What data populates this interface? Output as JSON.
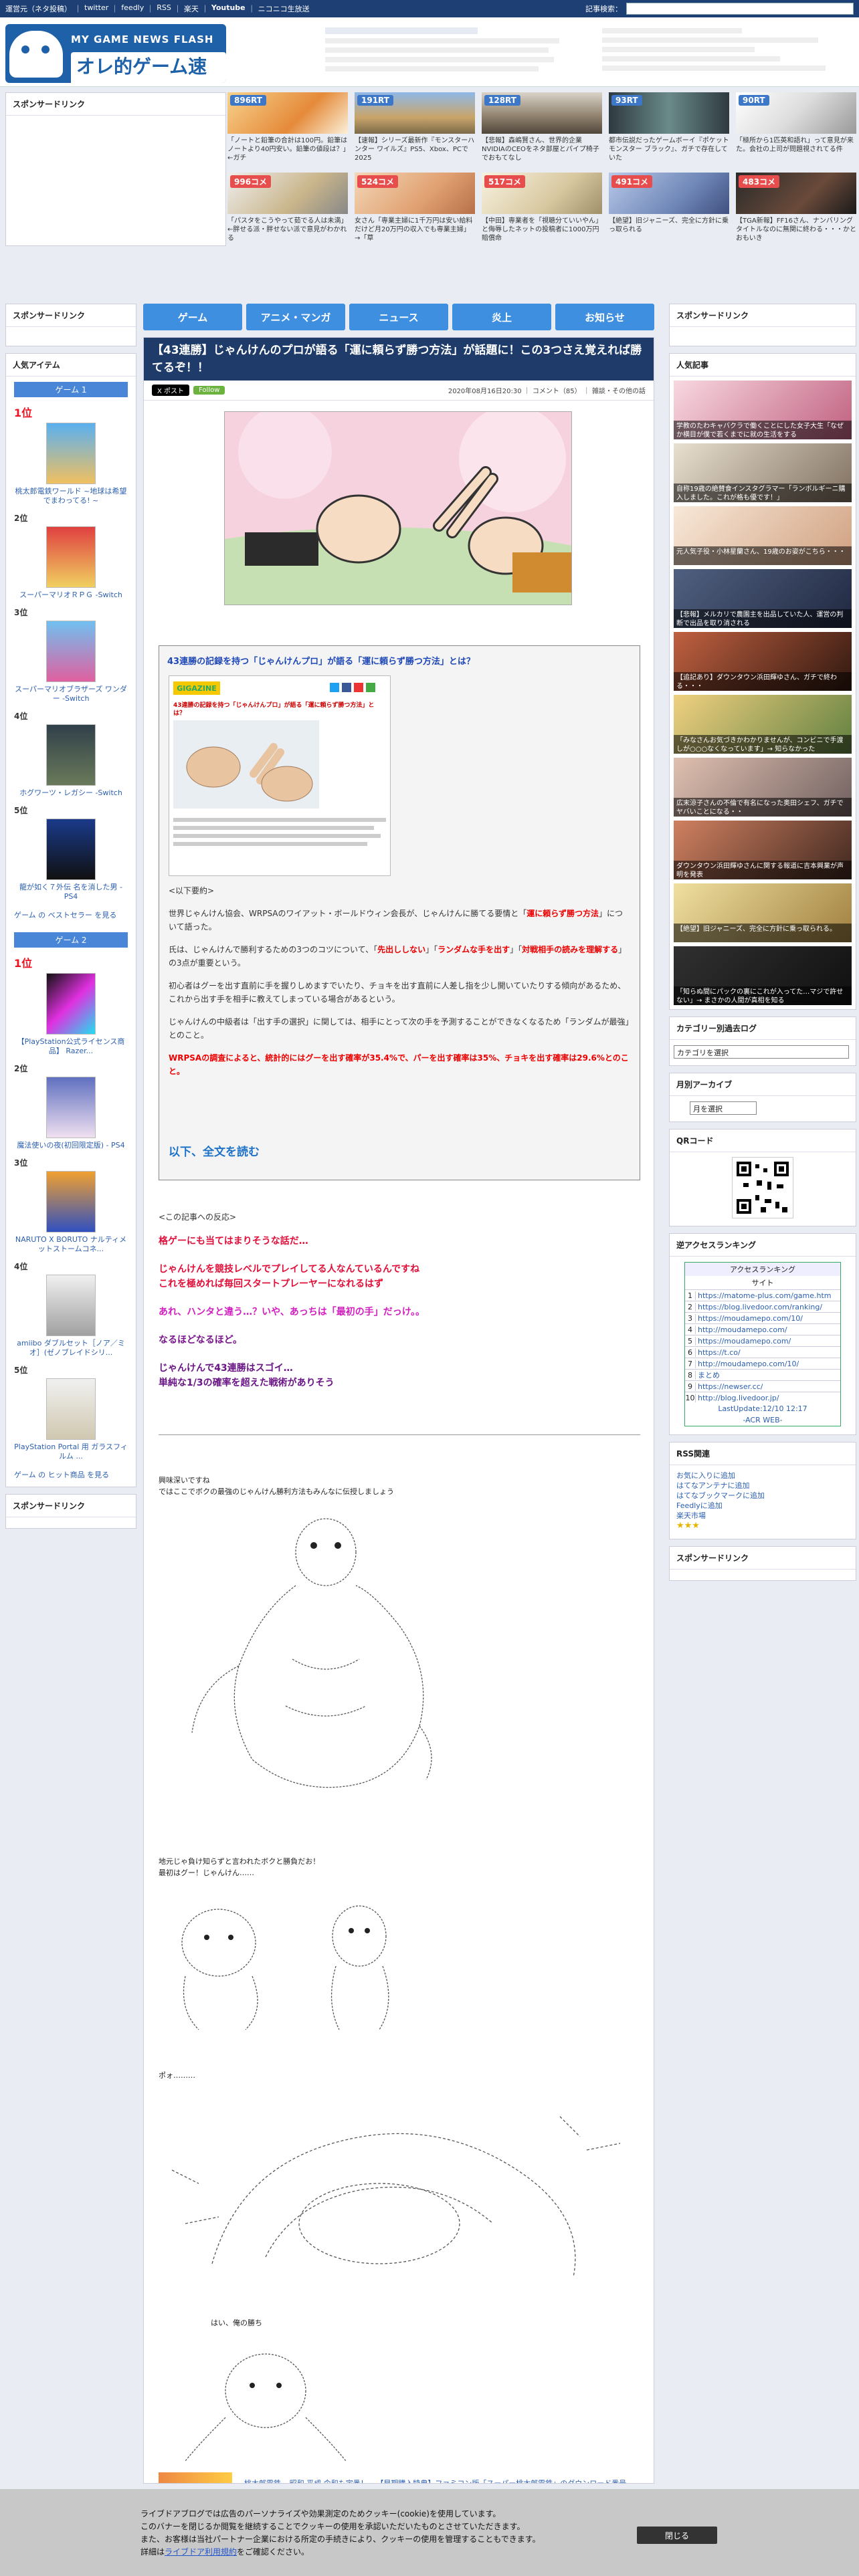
{
  "topbar": {
    "links": [
      "運営元（ネタ投稿）",
      "｜",
      "twitter",
      "｜",
      "feedly",
      "｜",
      "RSS",
      "｜",
      "楽天",
      "｜",
      "Youtube",
      "｜",
      "ニコニコ生放送"
    ],
    "search_label": "記事検索："
  },
  "header": {
    "logo_sub": "MY GAME NEWS FLASH",
    "logo_main": "オレ的ゲーム速報@JIN"
  },
  "sponsor": {
    "title": "スポンサードリンク"
  },
  "thumbs": [
    {
      "badge": "896RT",
      "text": "「ノートと鉛筆の合計は100円。鉛筆はノートより40円安い。鉛筆の値段は？」←ガチ"
    },
    {
      "badge": "191RT",
      "text": "【速報】シリーズ最新作『モンスターハンター ワイルズ』PS5、Xbox、PCで2025"
    },
    {
      "badge": "128RT",
      "text": "【悲報】森嶋賢さん、世界的企業NVIDIAのCEOをネタ部屋とパイプ椅子でおもてなし"
    },
    {
      "badge": "93RT",
      "text": "都市伝説だったゲームボーイ『ポケットモンスター ブラック』、ガチで存在していた"
    },
    {
      "badge": "90RT",
      "text": "「極所から1匹英和語れ」って意見が来た。会社の上司が問題視されてる件"
    },
    {
      "badge": "996コメ",
      "text": "「パスタをこうやって茹でる人は未満」←胖せる派・胖せない派で意見がわかれる"
    },
    {
      "badge": "524コメ",
      "text": "女さん「専業主婦に1千万円は安い給料だけど月20万円の収入でも専業主婦」→「草"
    },
    {
      "badge": "517コメ",
      "text": "【中田】専業者を「視聴分ていいやん」と侮辱したネットの投稿者に1000万円賠償命"
    },
    {
      "badge": "491コメ",
      "text": "【絶望】旧ジャニーズ、完全に方針に乗っ取られる"
    },
    {
      "badge": "483コメ",
      "text": "【TGA新報】FF16さん、ナンバリングタイトルなのに無関に終わる・・・かとおもいき"
    }
  ],
  "nav": [
    "ゲーム",
    "アニメ・マンガ",
    "ニュース",
    "炎上",
    "お知らせ"
  ],
  "left": {
    "sponsor_title": "スポンサードリンク",
    "popular_title": "人気アイテム",
    "game1_head": "ゲーム 1",
    "game2_head": "ゲーム 2",
    "ranks1": [
      {
        "num": "1位",
        "name": "桃太郎電鉄ワールド ~地球は希望でまわってる! ~"
      },
      {
        "num": "2位",
        "name": "スーパーマリオＲＰＧ -Switch"
      },
      {
        "num": "3位",
        "name": "スーパーマリオブラザーズ ワンダー -Switch"
      },
      {
        "num": "4位",
        "name": "ホグワーツ・レガシー -Switch"
      },
      {
        "num": "5位",
        "name": "龍が如く７外伝 名を消した男 - PS4"
      }
    ],
    "more1": "ゲーム の ベストセラー を見る",
    "ranks2": [
      {
        "num": "1位",
        "name": "【PlayStation公式ライセンス商品】 Razer..."
      },
      {
        "num": "2位",
        "name": "魔法使いの夜(初回限定版) - PS4"
      },
      {
        "num": "3位",
        "name": "NARUTO X BORUTO ナルティメットストームコネ..."
      },
      {
        "num": "4位",
        "name": "amiibo ダブルセット［ノア／ミオ］(ゼノブレイドシリ..."
      },
      {
        "num": "5位",
        "name": "PlayStation Portal 用 ガラスフィルム ..."
      }
    ],
    "more2": "ゲーム の ヒット商品 を見る",
    "sponsor2_title": "スポンサードリンク"
  },
  "article": {
    "title": "【43連勝】じゃんけんのプロが語る「運に頼らず勝つ方法」が話題に！この3つさえ覚えれば勝てるぞ！！",
    "share_x": "X ポスト",
    "share_f": "Follow",
    "meta": "2020年08月16日20:30 ｜ コメント（85） ｜ 雑談・その他の話",
    "quote_title": "43連勝の記録を持つ「じゃんけんプロ」が語る「運に頼らず勝つ方法」とは？",
    "shot_caption": "43連勝の記録を持つ「じゃんけんプロ」が語る「運に頼らず勝つ方法」とは？",
    "shot_logo": "GIGAZINE",
    "summary_head": "<以下要約>",
    "p1a": "世界じゃんけん協会、WRPSAのワイアット・ボールドウィン会長が、じゃんけんに勝てる要情と「",
    "p1b": "運に頼らず勝つ方法",
    "p1c": "」について語った。",
    "p2a": "氏は、じゃんけんで勝利するための3つのコツについて、「",
    "p2b": "先出ししない",
    "p2c": "」「",
    "p2d": "ランダムな手を出す",
    "p2e": "」「",
    "p2f": "対戦相手の読みを理解する",
    "p2g": "」の3点が重要という。",
    "p3": "初心者はグーを出す直前に手を握りしめますでいたり、チョキを出す直前に人差し指を少し開いていたりする傾向があるため、これから出す手を相手に教えてしまっている場合があるという。",
    "p4": "じゃんけんの中級者は「出す手の選択」に関しては、相手にとって次の手を予測することができなくなるため「ランダムが最強」とのこと。",
    "p5": "WRPSAの調査によると、統計的にはグーを出す確率が35.4%で、パーを出す確率は35%、チョキを出す確率は29.6%とのこと。",
    "readmore": "以下、全文を読む",
    "reaction_intro": "<この記事への反応>",
    "r1": "格ゲーにも当てはまりそうな話だ…",
    "r2a": "じゃんけんを競技レベルでプレイしてる人なんているんですね",
    "r2b": "これを極めれば毎回スタートプレーヤーになれるはず",
    "r3": "あれ、ハンタと違う…？いや、あっちは「最初の手」だっけ。。",
    "r4": "なるほどなるほど。",
    "r5a": "じゃんけんで43連勝はスゴイ…",
    "r5b": "単純な1/3の確率を超えた戦術がありそう",
    "aa1a": "興味深いですね",
    "aa1b": "ではここでボクの最強のじゃんけん勝利方法もみんなに伝授しましょう",
    "aa2a": "地元じゃ負け知らずと言われたボクと勝負だお！",
    "aa2b": "最初はグー！じゃんけん……",
    "aa3": "ポォ………",
    "aa4": "はい、俺の勝ち",
    "foot": "桃太郎電鉄 ~昭和 平成 令和も定番！~ 【早期購入特典】ファミコン版「スーパー桃太郎電鉄」のダウンロード番号"
  },
  "right": {
    "sponsor_title": "スポンサードリンク",
    "popular_title": "人気記事",
    "popular": [
      "学教のたわキャバクラで働くことにした女子大生「なぜか横目が僕で若くまでに就の生活をする",
      "自称19歳の絶賛食インスタグラマー「ランボルギーニ購入しました。これが格も優です！」",
      "元人気子役・小林星蘭さん、19歳のお姿がこちら・・・",
      "【悲報】メルカリで農園主を出品していた人、運営の判断で出品を取り消される",
      "【追記あり】ダウンタウン浜田輝ゆさん、ガチで終わる・・・",
      "「みなさんお気づきかわかりませんが、コンビニで手渡しが○○○なくなっています」→ 知らなかった",
      "広末涼子さんの不倫で有名になった奥田シェフ、ガチでヤバいことになる・・",
      "ダウンタウン浜田輝ゆさんに関する報道に吉本興業が声明を発表",
      "【絶望】旧ジャニーズ、完全に方針に乗っ取られる。",
      "「知らぬ間にパックの裏にこれが入ってた…マジで許せない」→ まさかの人間が真相を知る"
    ],
    "cat_title": "カテゴリー別過去ログ",
    "cat_select": "カテゴリを選択",
    "month_title": "月別アーカイブ",
    "month_select": "月を選択",
    "qr_title": "QRコード",
    "acr_title": "逆アクセスランキング",
    "acr_head": "アクセスランキング",
    "acr_sub": "サイト",
    "acr_rows": [
      {
        "n": "1",
        "u": "https://matome-plus.com/game.htm"
      },
      {
        "n": "2",
        "u": "https://blog.livedoor.com/ranking/"
      },
      {
        "n": "3",
        "u": "https://moudamepo.com/10/"
      },
      {
        "n": "4",
        "u": "http://moudamepo.com/"
      },
      {
        "n": "5",
        "u": "https://moudamepo.com/"
      },
      {
        "n": "6",
        "u": "https://t.co/"
      },
      {
        "n": "7",
        "u": "http://moudamepo.com/10/"
      },
      {
        "n": "8",
        "u": "まとめ"
      },
      {
        "n": "9",
        "u": "https://newser.cc/"
      },
      {
        "n": "10",
        "u": "http://blog.livedoor.jp/"
      }
    ],
    "acr_update": "LastUpdate:12/10 12:17",
    "acr_web": "-ACR WEB-",
    "rss_title": "RSS関連",
    "rss_links": [
      "お気に入りに追加",
      "はてなアンテナに追加",
      "はてなブックマークに追加",
      "Feedlyに追加",
      "楽天市場"
    ],
    "sponsor2_title": "スポンサードリンク"
  },
  "cookie": {
    "line1": "ライブドアブログでは広告のパーソナライズや効果測定のためクッキー(cookie)を使用しています。",
    "line2": "このバナーを閉じるか閲覧を継続することでクッキーの使用を承認いただいたものとさせていただきます。",
    "line3": "また、お客様は当社パートナー企業における所定の手続きにより、クッキーの使用を管理することもできます。",
    "line4a": "詳細は",
    "line4b": "ライブドア利用規約",
    "line4c": "をご確認ください。",
    "close": "閉じる"
  }
}
